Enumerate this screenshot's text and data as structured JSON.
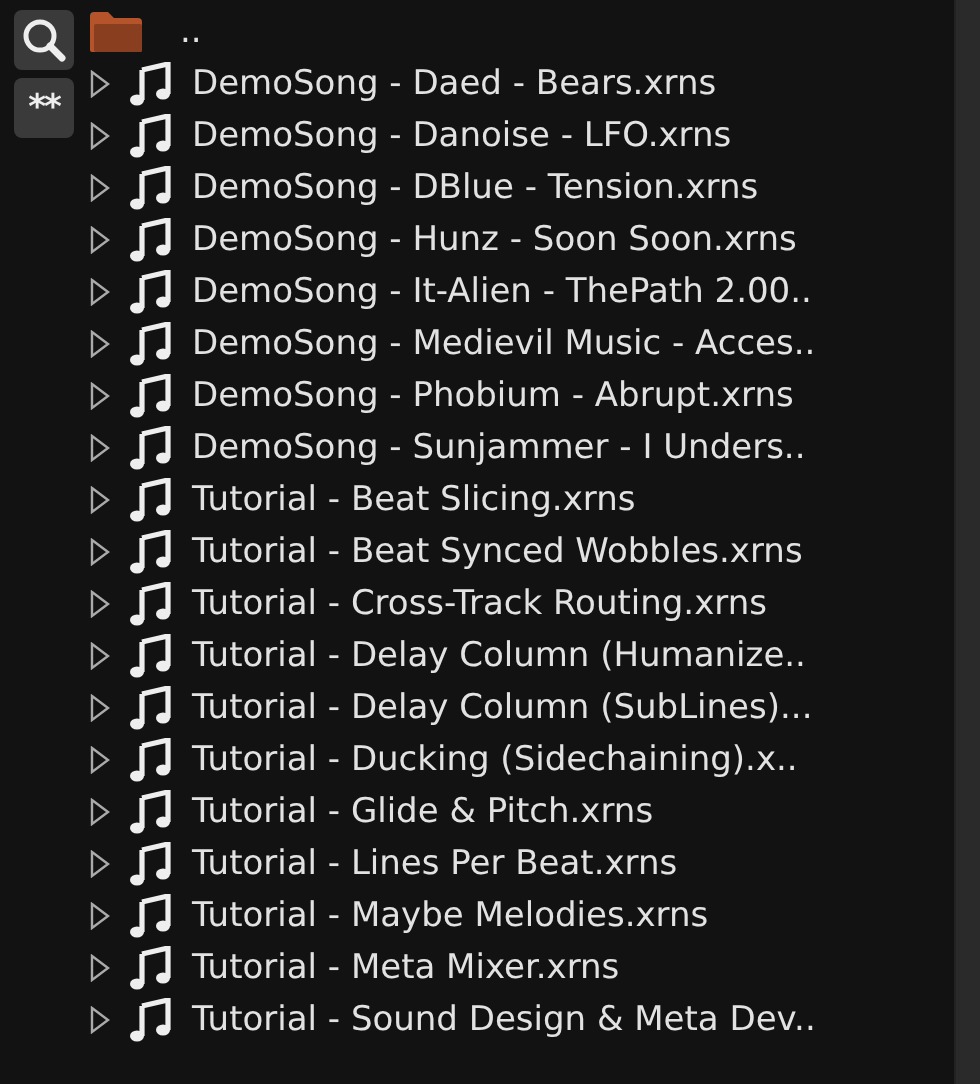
{
  "parent": {
    "label": ".."
  },
  "items": [
    {
      "name": "DemoSong - Daed - Bears.xrns",
      "expanded": false
    },
    {
      "name": "DemoSong - Danoise - LFO.xrns",
      "expanded": false
    },
    {
      "name": "DemoSong - DBlue - Tension.xrns",
      "expanded": false
    },
    {
      "name": "DemoSong - Hunz - Soon Soon.xrns",
      "expanded": false
    },
    {
      "name": "DemoSong - It-Alien - ThePath 2.00..",
      "expanded": false
    },
    {
      "name": "DemoSong - Medievil Music - Acces..",
      "expanded": false
    },
    {
      "name": "DemoSong - Phobium - Abrupt.xrns",
      "expanded": false
    },
    {
      "name": "DemoSong - Sunjammer - I Unders..",
      "expanded": false
    },
    {
      "name": "Tutorial - Beat Slicing.xrns",
      "expanded": false
    },
    {
      "name": "Tutorial - Beat Synced Wobbles.xrns",
      "expanded": false
    },
    {
      "name": "Tutorial - Cross-Track Routing.xrns",
      "expanded": false
    },
    {
      "name": "Tutorial - Delay Column (Humanize..",
      "expanded": false
    },
    {
      "name": "Tutorial - Delay Column (SubLines)...",
      "expanded": false
    },
    {
      "name": "Tutorial - Ducking (Sidechaining).x..",
      "expanded": false
    },
    {
      "name": "Tutorial - Glide & Pitch.xrns",
      "expanded": false
    },
    {
      "name": "Tutorial - Lines Per Beat.xrns",
      "expanded": false
    },
    {
      "name": "Tutorial - Maybe Melodies.xrns",
      "expanded": false
    },
    {
      "name": "Tutorial - Meta Mixer.xrns",
      "expanded": false
    },
    {
      "name": "Tutorial - Sound Design & Meta Dev..",
      "expanded": false
    }
  ],
  "filter_button": {
    "label": "**"
  }
}
